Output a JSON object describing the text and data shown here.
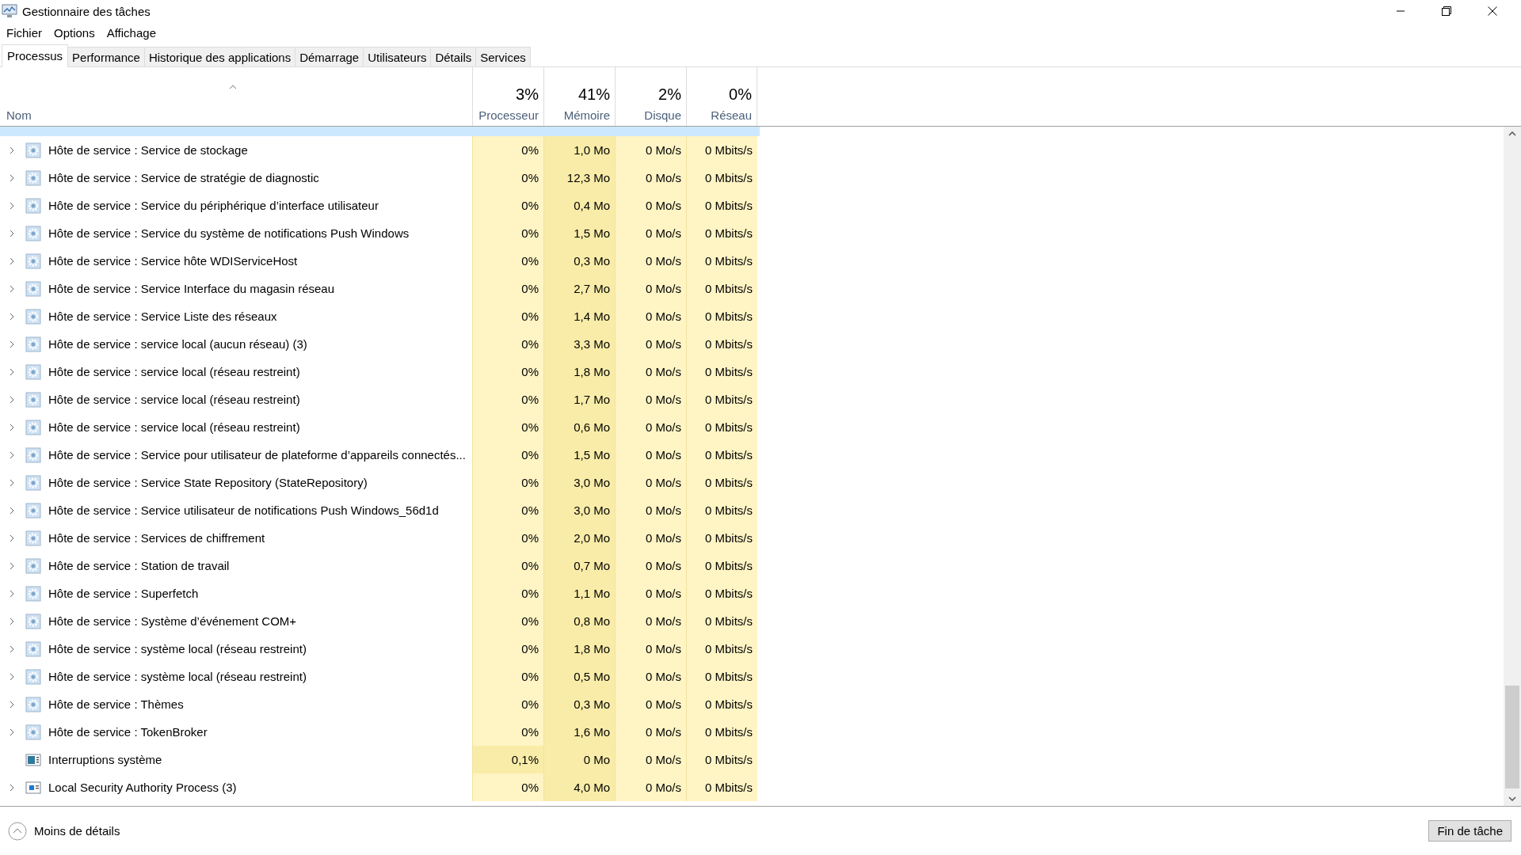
{
  "window": {
    "title": "Gestionnaire des tâches"
  },
  "menu": [
    "Fichier",
    "Options",
    "Affichage"
  ],
  "tabs": [
    {
      "label": "Processus",
      "selected": true
    },
    {
      "label": "Performance",
      "selected": false
    },
    {
      "label": "Historique des applications",
      "selected": false
    },
    {
      "label": "Démarrage",
      "selected": false
    },
    {
      "label": "Utilisateurs",
      "selected": false
    },
    {
      "label": "Détails",
      "selected": false
    },
    {
      "label": "Services",
      "selected": false
    }
  ],
  "table": {
    "name_column": "Nom",
    "columns": [
      {
        "percent": "3%",
        "label": "Processeur",
        "color": "#fff4c4"
      },
      {
        "percent": "41%",
        "label": "Mémoire",
        "color": "#f9eca8"
      },
      {
        "percent": "2%",
        "label": "Disque",
        "color": "#fff4c4"
      },
      {
        "percent": "0%",
        "label": "Réseau",
        "color": "#fff4c4"
      }
    ],
    "rows": [
      {
        "kind": "service",
        "expandable": true,
        "name": "Hôte de service : Service de stockage",
        "values": [
          "0%",
          "1,0 Mo",
          "0 Mo/s",
          "0 Mbits/s"
        ]
      },
      {
        "kind": "service",
        "expandable": true,
        "name": "Hôte de service : Service de stratégie de diagnostic",
        "values": [
          "0%",
          "12,3 Mo",
          "0 Mo/s",
          "0 Mbits/s"
        ]
      },
      {
        "kind": "service",
        "expandable": true,
        "name": "Hôte de service : Service du périphérique d’interface utilisateur",
        "values": [
          "0%",
          "0,4 Mo",
          "0 Mo/s",
          "0 Mbits/s"
        ]
      },
      {
        "kind": "service",
        "expandable": true,
        "name": "Hôte de service : Service du système de notifications Push Windows",
        "values": [
          "0%",
          "1,5 Mo",
          "0 Mo/s",
          "0 Mbits/s"
        ]
      },
      {
        "kind": "service",
        "expandable": true,
        "name": "Hôte de service : Service hôte WDIServiceHost",
        "values": [
          "0%",
          "0,3 Mo",
          "0 Mo/s",
          "0 Mbits/s"
        ]
      },
      {
        "kind": "service",
        "expandable": true,
        "name": "Hôte de service : Service Interface du magasin réseau",
        "values": [
          "0%",
          "2,7 Mo",
          "0 Mo/s",
          "0 Mbits/s"
        ]
      },
      {
        "kind": "service",
        "expandable": true,
        "name": "Hôte de service : Service Liste des réseaux",
        "values": [
          "0%",
          "1,4 Mo",
          "0 Mo/s",
          "0 Mbits/s"
        ]
      },
      {
        "kind": "service",
        "expandable": true,
        "name": "Hôte de service : service local (aucun réseau) (3)",
        "values": [
          "0%",
          "3,3 Mo",
          "0 Mo/s",
          "0 Mbits/s"
        ]
      },
      {
        "kind": "service",
        "expandable": true,
        "name": "Hôte de service : service local (réseau restreint)",
        "values": [
          "0%",
          "1,8 Mo",
          "0 Mo/s",
          "0 Mbits/s"
        ]
      },
      {
        "kind": "service",
        "expandable": true,
        "name": "Hôte de service : service local (réseau restreint)",
        "values": [
          "0%",
          "1,7 Mo",
          "0 Mo/s",
          "0 Mbits/s"
        ]
      },
      {
        "kind": "service",
        "expandable": true,
        "name": "Hôte de service : service local (réseau restreint)",
        "values": [
          "0%",
          "0,6 Mo",
          "0 Mo/s",
          "0 Mbits/s"
        ]
      },
      {
        "kind": "service",
        "expandable": true,
        "name": "Hôte de service : Service pour utilisateur de plateforme d’appareils connectés...",
        "values": [
          "0%",
          "1,5 Mo",
          "0 Mo/s",
          "0 Mbits/s"
        ]
      },
      {
        "kind": "service",
        "expandable": true,
        "name": "Hôte de service : Service State Repository (StateRepository)",
        "values": [
          "0%",
          "3,0 Mo",
          "0 Mo/s",
          "0 Mbits/s"
        ]
      },
      {
        "kind": "service",
        "expandable": true,
        "name": "Hôte de service : Service utilisateur de notifications Push Windows_56d1d",
        "values": [
          "0%",
          "3,0 Mo",
          "0 Mo/s",
          "0 Mbits/s"
        ]
      },
      {
        "kind": "service",
        "expandable": true,
        "name": "Hôte de service : Services de chiffrement",
        "values": [
          "0%",
          "2,0 Mo",
          "0 Mo/s",
          "0 Mbits/s"
        ]
      },
      {
        "kind": "service",
        "expandable": true,
        "name": "Hôte de service : Station de travail",
        "values": [
          "0%",
          "0,7 Mo",
          "0 Mo/s",
          "0 Mbits/s"
        ]
      },
      {
        "kind": "service",
        "expandable": true,
        "name": "Hôte de service : Superfetch",
        "values": [
          "0%",
          "1,1 Mo",
          "0 Mo/s",
          "0 Mbits/s"
        ]
      },
      {
        "kind": "service",
        "expandable": true,
        "name": "Hôte de service : Système d’événement COM+",
        "values": [
          "0%",
          "0,8 Mo",
          "0 Mo/s",
          "0 Mbits/s"
        ]
      },
      {
        "kind": "service",
        "expandable": true,
        "name": "Hôte de service : système local (réseau restreint)",
        "values": [
          "0%",
          "1,8 Mo",
          "0 Mo/s",
          "0 Mbits/s"
        ]
      },
      {
        "kind": "service",
        "expandable": true,
        "name": "Hôte de service : système local (réseau restreint)",
        "values": [
          "0%",
          "0,5 Mo",
          "0 Mo/s",
          "0 Mbits/s"
        ]
      },
      {
        "kind": "service",
        "expandable": true,
        "name": "Hôte de service : Thèmes",
        "values": [
          "0%",
          "0,3 Mo",
          "0 Mo/s",
          "0 Mbits/s"
        ]
      },
      {
        "kind": "service",
        "expandable": true,
        "name": "Hôte de service : TokenBroker",
        "values": [
          "0%",
          "1,6 Mo",
          "0 Mo/s",
          "0 Mbits/s"
        ]
      },
      {
        "kind": "interrupts",
        "expandable": false,
        "cpu_busy": true,
        "name": "Interruptions système",
        "values": [
          "0,1%",
          "0 Mo",
          "0 Mo/s",
          "0 Mbits/s"
        ]
      },
      {
        "kind": "process",
        "expandable": true,
        "name": "Local Security Authority Process (3)",
        "values": [
          "0%",
          "4,0 Mo",
          "0 Mo/s",
          "0 Mbits/s"
        ]
      }
    ]
  },
  "footer": {
    "details_link": "Moins de détails",
    "end_task_button": "Fin de tâche"
  }
}
